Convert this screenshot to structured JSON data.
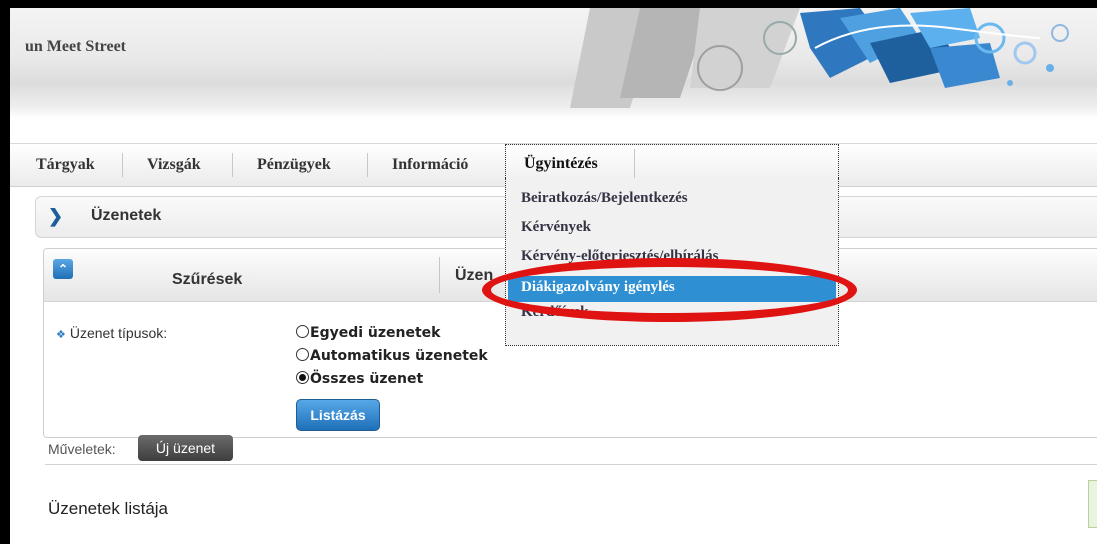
{
  "header": {
    "site_title": "un Meet Street"
  },
  "nav": {
    "items": [
      "Tárgyak",
      "Vizsgák",
      "Pénzügyek",
      "Információ"
    ],
    "active": "Ügyintézés"
  },
  "dropdown": {
    "items": [
      "Beiratkozás/Bejelentkezés",
      "Kérvények",
      "Kérvény-előterjesztés/elbírálás",
      "Diákigazolvány igénylés",
      "Kérdőívek"
    ],
    "highlighted_index": 3
  },
  "messages_panel": {
    "title": "Üzenetek"
  },
  "filter": {
    "title": "Szűrések",
    "title2": "Üzen",
    "type_label": "Üzenet típusok:",
    "options": [
      "Egyedi üzenetek",
      "Automatikus üzenetek",
      "Összes üzenet"
    ],
    "selected_option": "Összes üzenet",
    "list_button": "Listázás"
  },
  "operations": {
    "label": "Műveletek:",
    "new_message_button": "Új üzenet"
  },
  "list": {
    "title": "Üzenetek listája"
  },
  "colors": {
    "highlight": "#2f8fd3",
    "annotation_oval": "#e01313",
    "button_blue": "#1d6fb8"
  }
}
